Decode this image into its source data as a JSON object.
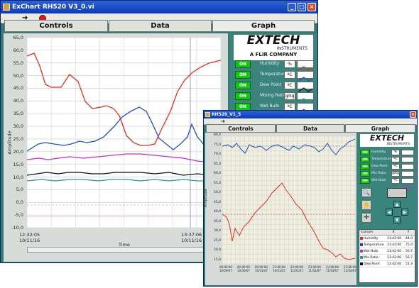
{
  "win1": {
    "title": "ExChart RH520 V3_0.vi",
    "tabs": [
      "Controls",
      "Data",
      "Graph"
    ],
    "logo": {
      "brand": "EXTECH",
      "sub": "INSTRUMENTS",
      "tag": "A FLIR COMPANY"
    },
    "y_ticks": [
      "65,0",
      "60,0",
      "55,0",
      "50,0",
      "45,0",
      "40,0",
      "35,0",
      "30,0",
      "25,0",
      "20,0",
      "15,0",
      "10,0",
      "5,0",
      "0,0",
      "-5,0",
      "-10,0"
    ],
    "ylabel": "Amplitude",
    "xlabel": "Time",
    "x_start": {
      "time": "12:32:05",
      "date": "10/11/16"
    },
    "x_end": {
      "time": "13:37:06",
      "date": "10/11/16"
    },
    "rows": [
      {
        "label": "Humidity",
        "unit": "%",
        "color": "#e03020"
      },
      {
        "label": "Temperature",
        "unit": "ºC",
        "color": "#2050c0"
      },
      {
        "label": "Dew Point",
        "unit": "ºC",
        "color": "#111111"
      },
      {
        "label": "Mixing Ratio",
        "unit": "g/kg",
        "color": "#20a090"
      },
      {
        "label": "Wet Bulb",
        "unit": "ºC",
        "color": "#c030c0"
      }
    ],
    "on": "ON"
  },
  "win2": {
    "title": "RH520_V1_5",
    "tabs": [
      "Controls",
      "Data",
      "Graph"
    ],
    "logo": {
      "brand": "EXTECH",
      "sub": "INSTRUMENTS"
    },
    "y_ticks": [
      "80,0",
      "75,0",
      "70,0",
      "65,0",
      "60,0",
      "55,0",
      "50,0",
      "45,0",
      "40,0",
      "35,0",
      "30,0",
      "25,0",
      "20,0",
      "15,0"
    ],
    "rows": [
      {
        "label": "Humidity",
        "unit": "%",
        "color": "#e03020"
      },
      {
        "label": "Temperature",
        "unit": "ºC",
        "color": "#2050c0"
      },
      {
        "label": "Dew Point",
        "unit": "ºC",
        "color": "#111111"
      },
      {
        "label": "Mix Ratio",
        "unit": "g/kg",
        "color": "#20a090"
      },
      {
        "label": "Wet Bulb",
        "unit": "ºC",
        "color": "#c030c0"
      }
    ],
    "on": "ON",
    "cursor_headers": [
      "Cursors",
      "X",
      "Y"
    ],
    "cursors": [
      {
        "name": "Humidity",
        "x": "11:42:00",
        "y": "44.0"
      },
      {
        "name": "Temperature",
        "x": "11:42:00",
        "y": "75.0"
      },
      {
        "name": "Wet Bulb",
        "x": "11:42:00",
        "y": "56.7"
      },
      {
        "name": "Mix Ratio",
        "x": "11:42:00",
        "y": "56.7"
      },
      {
        "name": "Dew Point",
        "x": "11:42:00",
        "y": "51.3"
      }
    ],
    "x_ticks": [
      {
        "time": "00:00:00",
        "date": "10/29/07"
      },
      {
        "time": "00:00:00",
        "date": "10/30/07"
      },
      {
        "time": "00:00:00",
        "date": "10/31/07"
      },
      {
        "time": "23:00:00",
        "date": "10/31/07"
      },
      {
        "time": "23:00:00",
        "date": "11/01/07"
      },
      {
        "time": "23:00:00",
        "date": "11/02/07"
      },
      {
        "time": "23:00:00",
        "date": "11/03/07"
      },
      {
        "time": "23:00:00",
        "date": "11/04/07"
      }
    ],
    "ylabel": "Amplitude"
  }
}
